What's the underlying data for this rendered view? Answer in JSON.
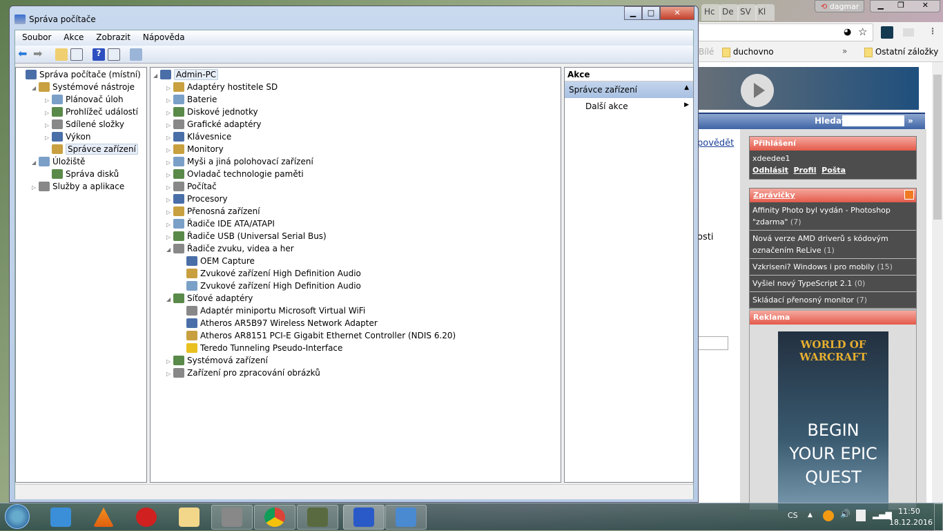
{
  "browser": {
    "tabs": [
      "Hc",
      "De",
      "SV",
      "Kl"
    ],
    "profile": "dagmar",
    "bookmarks": [
      "Bílé",
      "duchovno",
      "Ostatní záložky"
    ],
    "overflow": "»",
    "search_label": "Hledat:",
    "search_go": "»",
    "page_fragments": [
      "povědět",
      "osti"
    ],
    "login": {
      "title": "Přihlášení",
      "user": "xdeedee1",
      "links": [
        "Odhlásit",
        "Profil",
        "Pošta"
      ]
    },
    "news": {
      "title": "Zprávičky",
      "items": [
        {
          "text": "Affinity Photo byl vydán - Photoshop \"zdarma\"",
          "count": "(7)"
        },
        {
          "text": "Nová verze AMD driverů s kódovým označením ReLive",
          "count": "(1)"
        },
        {
          "text": "Vzkriseni? Windows i pro mobily",
          "count": "(15)"
        },
        {
          "text": "Vyšiel nový TypeScript 2.1",
          "count": "(0)"
        },
        {
          "text": "Skládací přenosný monitor",
          "count": "(7)"
        }
      ]
    },
    "ad": {
      "title": "Reklama",
      "logo": "WORLD OF WARCRAFT",
      "lines": [
        "BEGIN",
        "YOUR EPIC",
        "QUEST"
      ]
    }
  },
  "window": {
    "title": "Správa počítače",
    "menu": [
      "Soubor",
      "Akce",
      "Zobrazit",
      "Nápověda"
    ],
    "nav_tree": [
      {
        "label": "Správa počítače (místní)",
        "level": 0,
        "exp": ""
      },
      {
        "label": "Systémové nástroje",
        "level": 1,
        "exp": "◢"
      },
      {
        "label": "Plánovač úloh",
        "level": 2,
        "exp": "▷"
      },
      {
        "label": "Prohlížeč událostí",
        "level": 2,
        "exp": "▷"
      },
      {
        "label": "Sdílené složky",
        "level": 2,
        "exp": "▷"
      },
      {
        "label": "Výkon",
        "level": 2,
        "exp": "▷"
      },
      {
        "label": "Správce zařízení",
        "level": 2,
        "exp": "",
        "selected": true
      },
      {
        "label": "Úložiště",
        "level": 1,
        "exp": "◢"
      },
      {
        "label": "Správa disků",
        "level": 2,
        "exp": ""
      },
      {
        "label": "Služby a aplikace",
        "level": 1,
        "exp": "▷"
      }
    ],
    "device_tree": [
      {
        "label": "Admin-PC",
        "level": 0,
        "exp": "◢"
      },
      {
        "label": "Adaptéry hostitele SD",
        "level": 1,
        "exp": "▷"
      },
      {
        "label": "Baterie",
        "level": 1,
        "exp": "▷"
      },
      {
        "label": "Diskové jednotky",
        "level": 1,
        "exp": "▷"
      },
      {
        "label": "Grafické adaptéry",
        "level": 1,
        "exp": "▷"
      },
      {
        "label": "Klávesnice",
        "level": 1,
        "exp": "▷"
      },
      {
        "label": "Monitory",
        "level": 1,
        "exp": "▷"
      },
      {
        "label": "Myši a jiná polohovací zařízení",
        "level": 1,
        "exp": "▷"
      },
      {
        "label": "Ovladač technologie paměti",
        "level": 1,
        "exp": "▷"
      },
      {
        "label": "Počítač",
        "level": 1,
        "exp": "▷"
      },
      {
        "label": "Procesory",
        "level": 1,
        "exp": "▷"
      },
      {
        "label": "Přenosná zařízení",
        "level": 1,
        "exp": "▷"
      },
      {
        "label": "Řadiče IDE ATA/ATAPI",
        "level": 1,
        "exp": "▷"
      },
      {
        "label": "Řadiče USB (Universal Serial Bus)",
        "level": 1,
        "exp": "▷"
      },
      {
        "label": "Řadiče zvuku, videa a her",
        "level": 1,
        "exp": "◢"
      },
      {
        "label": "OEM Capture",
        "level": 2,
        "exp": ""
      },
      {
        "label": "Zvukové zařízení High Definition Audio",
        "level": 2,
        "exp": ""
      },
      {
        "label": "Zvukové zařízení High Definition Audio",
        "level": 2,
        "exp": ""
      },
      {
        "label": "Síťové adaptéry",
        "level": 1,
        "exp": "◢"
      },
      {
        "label": "Adaptér miniportu Microsoft Virtual WiFi",
        "level": 2,
        "exp": ""
      },
      {
        "label": "Atheros AR5B97 Wireless Network Adapter",
        "level": 2,
        "exp": ""
      },
      {
        "label": "Atheros AR8151 PCI-E Gigabit Ethernet Controller (NDIS 6.20)",
        "level": 2,
        "exp": ""
      },
      {
        "label": "Teredo Tunneling Pseudo-Interface",
        "level": 2,
        "exp": "",
        "warning": true
      },
      {
        "label": "Systémová zařízení",
        "level": 1,
        "exp": "▷"
      },
      {
        "label": "Zařízení pro zpracování obrázků",
        "level": 1,
        "exp": "▷"
      }
    ],
    "actions": {
      "title": "Akce",
      "section": "Správce zařízení",
      "item": "Další akce"
    }
  },
  "tray": {
    "lang": "CS",
    "time": "11:50",
    "date": "18.12.2016"
  }
}
